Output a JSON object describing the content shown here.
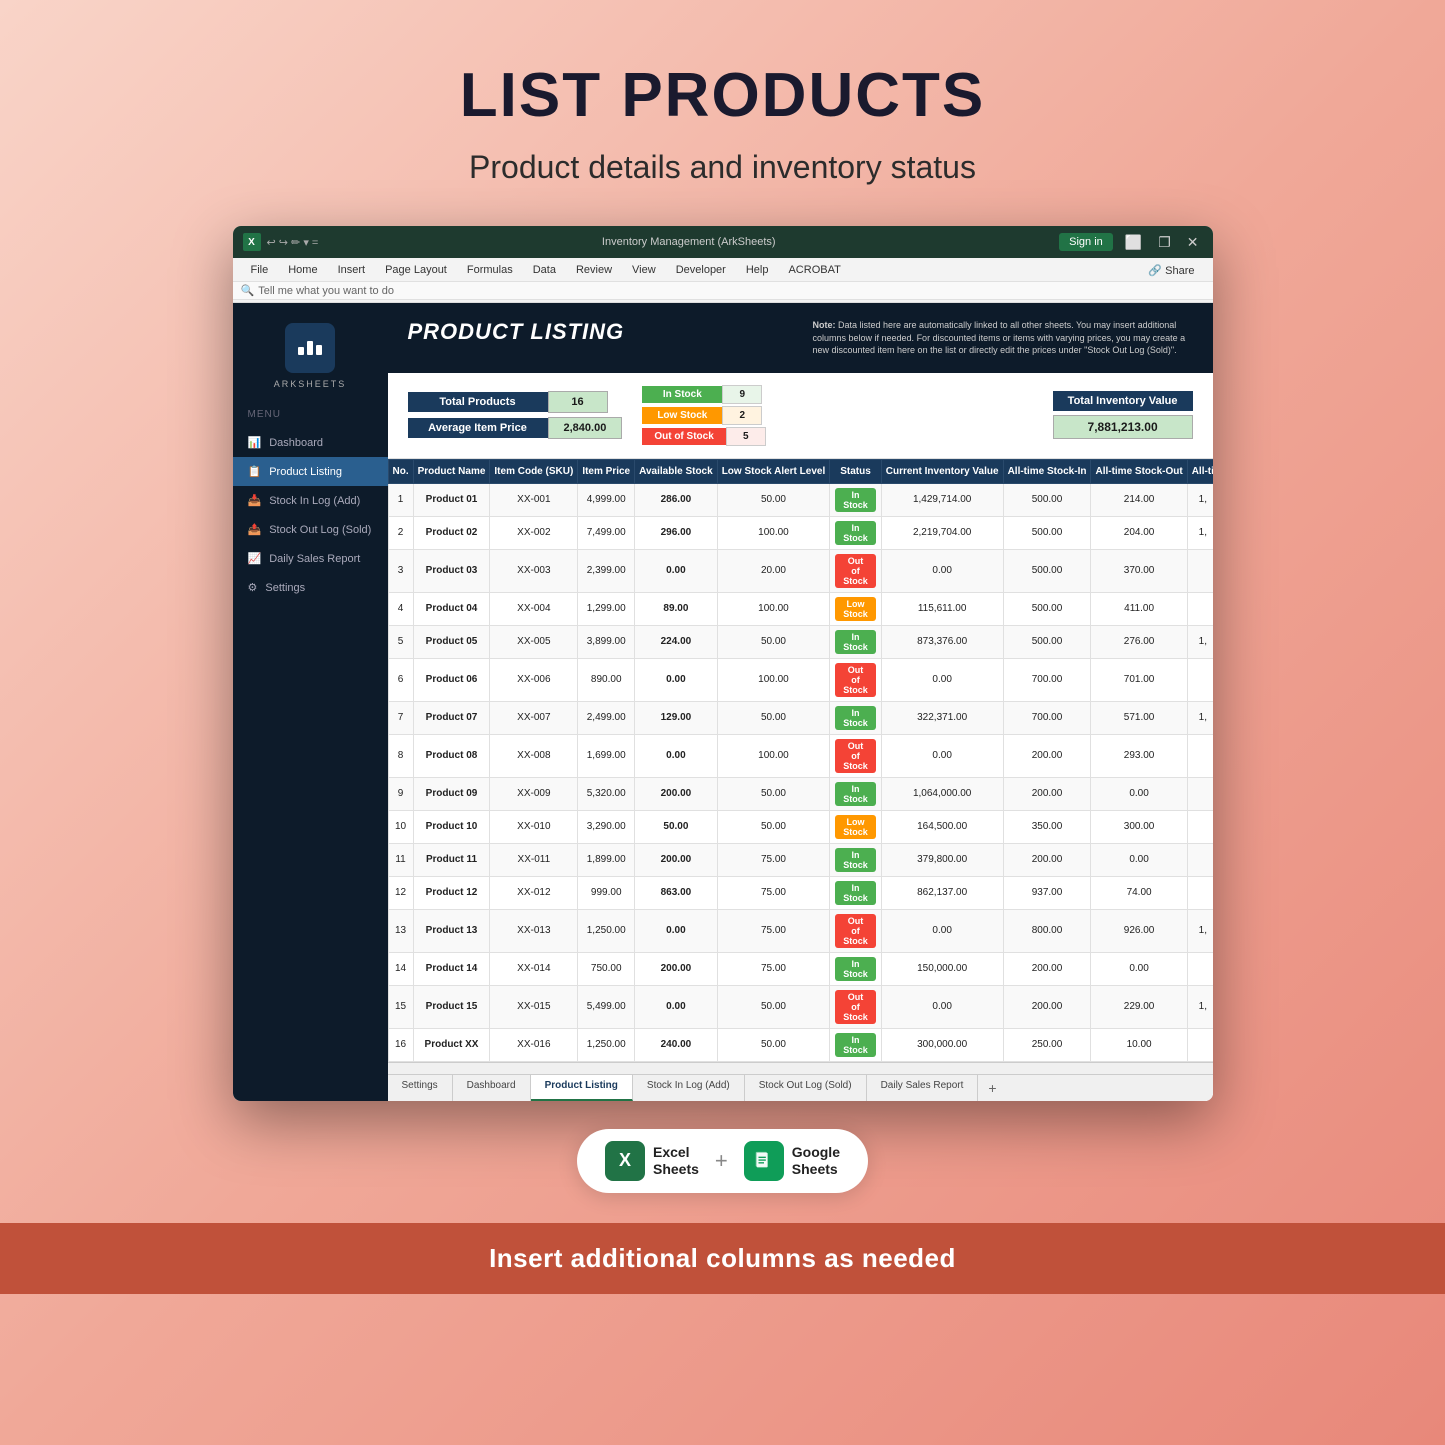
{
  "page": {
    "title": "LIST PRODUCTS",
    "subtitle": "Product details and inventory status",
    "footer_text": "Insert additional columns as needed"
  },
  "window": {
    "title": "Inventory Management (ArkSheets)",
    "signin": "Sign in"
  },
  "ribbon": {
    "tabs": [
      "File",
      "Home",
      "Insert",
      "Page Layout",
      "Formulas",
      "Data",
      "Review",
      "View",
      "Developer",
      "Help",
      "ACROBAT"
    ],
    "search_placeholder": "Tell me what you want to do",
    "share": "Share"
  },
  "sidebar": {
    "brand": "ArkSheets",
    "menu_label": "Menu",
    "items": [
      {
        "label": "Dashboard",
        "icon": "chart-icon",
        "active": false
      },
      {
        "label": "Product Listing",
        "icon": "list-icon",
        "active": true
      },
      {
        "label": "Stock In Log (Add)",
        "icon": "stockin-icon",
        "active": false
      },
      {
        "label": "Stock Out Log (Sold)",
        "icon": "stockout-icon",
        "active": false
      },
      {
        "label": "Daily Sales Report",
        "icon": "report-icon",
        "active": false
      },
      {
        "label": "Settings",
        "icon": "gear-icon",
        "active": false
      }
    ]
  },
  "sheet_header": {
    "title": "PRODUCT LISTING",
    "note_prefix": "Note:",
    "note_text": " Data listed here are automatically linked to all other sheets. You may insert additional columns below if needed. For discounted items or items with varying prices, you may create a new discounted item here on the list or directly edit the prices under \"Stock Out Log (Sold)\"."
  },
  "stats": {
    "total_products_label": "Total Products",
    "total_products_value": "16",
    "avg_price_label": "Average Item Price",
    "avg_price_value": "2,840.00",
    "in_stock_label": "In Stock",
    "in_stock_value": "9",
    "low_stock_label": "Low Stock",
    "low_stock_value": "2",
    "out_stock_label": "Out of Stock",
    "out_stock_value": "5",
    "inventory_label": "Total Inventory Value",
    "inventory_value": "7,881,213.00"
  },
  "table": {
    "headers": [
      "No.",
      "Product Name",
      "Item Code (SKU)",
      "Item Price",
      "Available Stock",
      "Low Stock Alert Level",
      "Status",
      "Current Inventory Value",
      "All-time Stock-In",
      "All-time Stock-Out",
      "All-ti"
    ],
    "rows": [
      {
        "no": "1",
        "name": "Product 01",
        "sku": "XX-001",
        "price": "4,999.00",
        "stock": "286.00",
        "alert": "50.00",
        "status": "In Stock",
        "inv_value": "1,429,714.00",
        "stock_in": "500.00",
        "stock_out": "214.00",
        "allti": "1,"
      },
      {
        "no": "2",
        "name": "Product 02",
        "sku": "XX-002",
        "price": "7,499.00",
        "stock": "296.00",
        "alert": "100.00",
        "status": "In Stock",
        "inv_value": "2,219,704.00",
        "stock_in": "500.00",
        "stock_out": "204.00",
        "allti": "1,"
      },
      {
        "no": "3",
        "name": "Product 03",
        "sku": "XX-003",
        "price": "2,399.00",
        "stock": "0.00",
        "alert": "20.00",
        "status": "Out of Stock",
        "inv_value": "0.00",
        "stock_in": "500.00",
        "stock_out": "370.00",
        "allti": ""
      },
      {
        "no": "4",
        "name": "Product 04",
        "sku": "XX-004",
        "price": "1,299.00",
        "stock": "89.00",
        "alert": "100.00",
        "status": "Low Stock",
        "inv_value": "115,611.00",
        "stock_in": "500.00",
        "stock_out": "411.00",
        "allti": ""
      },
      {
        "no": "5",
        "name": "Product 05",
        "sku": "XX-005",
        "price": "3,899.00",
        "stock": "224.00",
        "alert": "50.00",
        "status": "In Stock",
        "inv_value": "873,376.00",
        "stock_in": "500.00",
        "stock_out": "276.00",
        "allti": "1,"
      },
      {
        "no": "6",
        "name": "Product 06",
        "sku": "XX-006",
        "price": "890.00",
        "stock": "0.00",
        "alert": "100.00",
        "status": "Out of Stock",
        "inv_value": "0.00",
        "stock_in": "700.00",
        "stock_out": "701.00",
        "allti": ""
      },
      {
        "no": "7",
        "name": "Product 07",
        "sku": "XX-007",
        "price": "2,499.00",
        "stock": "129.00",
        "alert": "50.00",
        "status": "In Stock",
        "inv_value": "322,371.00",
        "stock_in": "700.00",
        "stock_out": "571.00",
        "allti": "1,"
      },
      {
        "no": "8",
        "name": "Product 08",
        "sku": "XX-008",
        "price": "1,699.00",
        "stock": "0.00",
        "alert": "100.00",
        "status": "Out of Stock",
        "inv_value": "0.00",
        "stock_in": "200.00",
        "stock_out": "293.00",
        "allti": ""
      },
      {
        "no": "9",
        "name": "Product 09",
        "sku": "XX-009",
        "price": "5,320.00",
        "stock": "200.00",
        "alert": "50.00",
        "status": "In Stock",
        "inv_value": "1,064,000.00",
        "stock_in": "200.00",
        "stock_out": "0.00",
        "allti": ""
      },
      {
        "no": "10",
        "name": "Product 10",
        "sku": "XX-010",
        "price": "3,290.00",
        "stock": "50.00",
        "alert": "50.00",
        "status": "Low Stock",
        "inv_value": "164,500.00",
        "stock_in": "350.00",
        "stock_out": "300.00",
        "allti": ""
      },
      {
        "no": "11",
        "name": "Product 11",
        "sku": "XX-011",
        "price": "1,899.00",
        "stock": "200.00",
        "alert": "75.00",
        "status": "In Stock",
        "inv_value": "379,800.00",
        "stock_in": "200.00",
        "stock_out": "0.00",
        "allti": ""
      },
      {
        "no": "12",
        "name": "Product 12",
        "sku": "XX-012",
        "price": "999.00",
        "stock": "863.00",
        "alert": "75.00",
        "status": "In Stock",
        "inv_value": "862,137.00",
        "stock_in": "937.00",
        "stock_out": "74.00",
        "allti": ""
      },
      {
        "no": "13",
        "name": "Product 13",
        "sku": "XX-013",
        "price": "1,250.00",
        "stock": "0.00",
        "alert": "75.00",
        "status": "Out of Stock",
        "inv_value": "0.00",
        "stock_in": "800.00",
        "stock_out": "926.00",
        "allti": "1,"
      },
      {
        "no": "14",
        "name": "Product 14",
        "sku": "XX-014",
        "price": "750.00",
        "stock": "200.00",
        "alert": "75.00",
        "status": "In Stock",
        "inv_value": "150,000.00",
        "stock_in": "200.00",
        "stock_out": "0.00",
        "allti": ""
      },
      {
        "no": "15",
        "name": "Product 15",
        "sku": "XX-015",
        "price": "5,499.00",
        "stock": "0.00",
        "alert": "50.00",
        "status": "Out of Stock",
        "inv_value": "0.00",
        "stock_in": "200.00",
        "stock_out": "229.00",
        "allti": "1,"
      },
      {
        "no": "16",
        "name": "Product XX",
        "sku": "XX-016",
        "price": "1,250.00",
        "stock": "240.00",
        "alert": "50.00",
        "status": "In Stock",
        "inv_value": "300,000.00",
        "stock_in": "250.00",
        "stock_out": "10.00",
        "allti": ""
      }
    ]
  },
  "sheet_tabs": {
    "tabs": [
      "Settings",
      "Dashboard",
      "Product Listing",
      "Stock In Log (Add)",
      "Stock Out Log (Sold)",
      "Daily Sales Report"
    ],
    "active": "Product Listing"
  },
  "bottom_badges": {
    "excel_label": "Excel\nSheets",
    "sheets_label": "Google\nSheets",
    "plus": "+"
  }
}
